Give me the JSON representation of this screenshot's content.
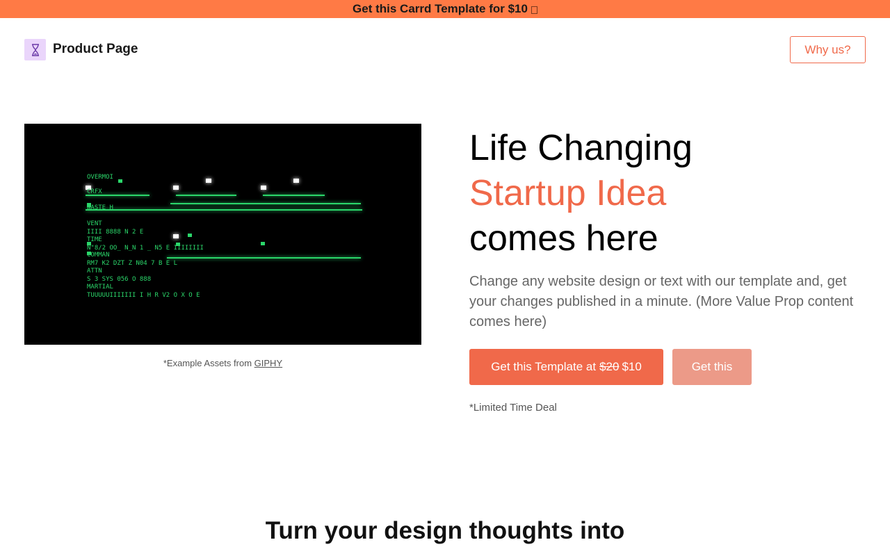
{
  "banner": {
    "text": "Get this Carrd Template for $10"
  },
  "header": {
    "brand": "Product Page",
    "why_button": "Why us?"
  },
  "hero": {
    "headline_line1": "Life Changing",
    "headline_accent": "Startup Idea",
    "headline_line3": "comes here",
    "lead": "Change any website design or text with our template and, get your changes published in a minute. (More Value Prop content comes here)",
    "cta_primary_prefix": "Get this Template at",
    "cta_primary_old_price": "$20",
    "cta_primary_new_price": "$10",
    "cta_secondary": "Get this",
    "deal_note": "*Limited Time Deal"
  },
  "media": {
    "caption_prefix": "*Example Assets from",
    "caption_link": "GIPHY",
    "terminal_lines": [
      "OVERMOI",
      "CRFX",
      "WASTE H",
      "VENT",
      "IIII    8888       N 2          E",
      "TIME",
      "N\"8/2   OO_     N_N    1   _  N5   E       IIIIIIII",
      "COMMAN",
      "RM7    K2       DZT    Z     N04  7 B    E  L",
      "ATTN",
      "S      3       SYS 056    O      888",
      "MARTIAL",
      "TUUUUUIIIIIII       I      H R V2   O X       O       E"
    ]
  },
  "section2": {
    "title": "Turn your design thoughts into"
  },
  "colors": {
    "accent": "#f0694a",
    "banner": "#ff7a45",
    "logo_bg": "#ead5fb",
    "terminal_green": "#2bd66a"
  }
}
